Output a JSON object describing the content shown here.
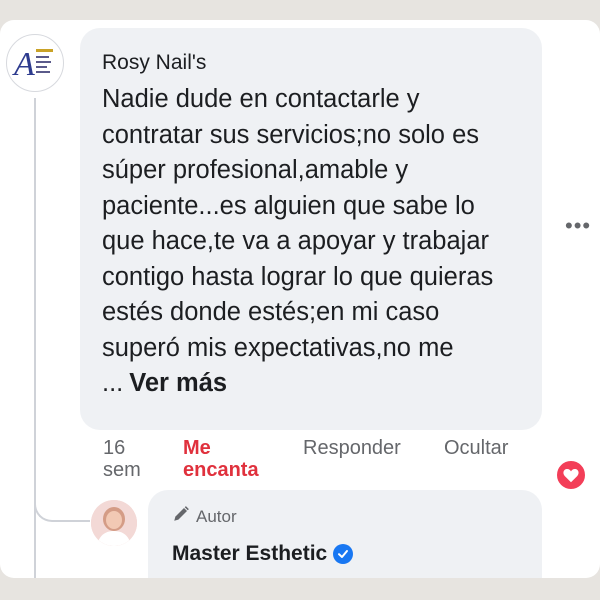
{
  "comment": {
    "author": "Rosy Nail's",
    "text": "Nadie dude en contactarle y contratar sus servicios;no solo es súper profesional,amable y paciente...es alguien que sabe lo que hace,te va a apoyar y trabajar contigo hasta lograr lo que quieras estés donde estés;en mi caso superó mis expectativas,no me ...",
    "see_more": "Ver más",
    "more_icon": "more-horizontal-icon",
    "actions": {
      "time": "16 sem",
      "love": "Me encanta",
      "reply": "Responder",
      "hide": "Ocultar"
    },
    "reaction_icon": "love-reaction-icon"
  },
  "reply": {
    "badge_label": "Autor",
    "badge_icon": "pencil-icon",
    "author": "Master Esthetic",
    "verified_icon": "verified-badge-icon"
  },
  "colors": {
    "love_red": "#e0313d",
    "bubble_bg": "#eff1f4",
    "verified_blue": "#1877f2",
    "reaction_heart": "#f33e58"
  }
}
